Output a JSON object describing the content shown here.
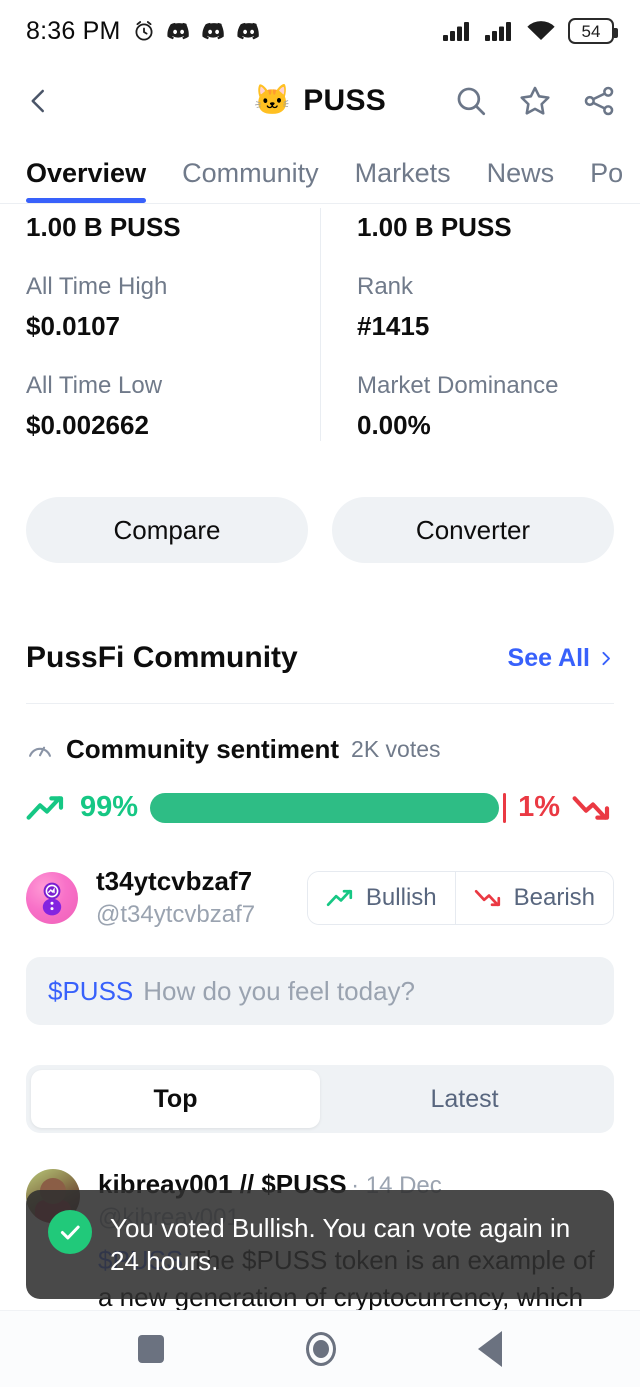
{
  "status_bar": {
    "time": "8:36 PM",
    "alarm_icon": "alarm-icon",
    "app_icons": [
      "discord-icon",
      "discord-icon",
      "discord-icon"
    ],
    "signal_icons": [
      "signal-bars-icon",
      "signal-bars-icon"
    ],
    "wifi_icon": "wifi-icon",
    "battery_percent": "54"
  },
  "app_bar": {
    "back_icon": "chevron-left-icon",
    "coin_logo": "🐱",
    "coin_name": "PUSS",
    "search_icon": "search-icon",
    "favorite_icon": "star-icon",
    "share_icon": "share-icon"
  },
  "tabs": [
    {
      "label": "Overview",
      "active": true
    },
    {
      "label": "Community",
      "active": false
    },
    {
      "label": "Markets",
      "active": false
    },
    {
      "label": "News",
      "active": false
    },
    {
      "label": "Po",
      "active": false
    }
  ],
  "stats": {
    "left": {
      "top_value": "1.00 B PUSS",
      "rows": [
        {
          "label": "All Time High",
          "value": "$0.0107"
        },
        {
          "label": "All Time Low",
          "value": "$0.002662"
        }
      ]
    },
    "right": {
      "top_value": "1.00 B PUSS",
      "rows": [
        {
          "label": "Rank",
          "value": "#1415"
        },
        {
          "label": "Market Dominance",
          "value": "0.00%"
        }
      ]
    }
  },
  "actions": {
    "compare_label": "Compare",
    "converter_label": "Converter"
  },
  "community": {
    "section_title": "PussFi Community",
    "see_all_label": "See All",
    "see_all_chevron": "chevron-right-icon",
    "sentiment": {
      "icon": "gauge-icon",
      "title": "Community sentiment",
      "votes": "2K votes",
      "bullish_pct": "99%",
      "bearish_pct": "1%",
      "bullish_value": 99,
      "bearish_value": 1,
      "bullish_color": "#2ebd85",
      "bearish_color": "#ea3943",
      "bullish_icon": "trend-up-icon",
      "bearish_icon": "trend-down-icon"
    },
    "current_user": {
      "name": "t34ytcvbzaf7",
      "handle": "@t34ytcvbzaf7",
      "avatar_icon": "cmc-avatar-icon",
      "bullish_label": "Bullish",
      "bearish_label": "Bearish"
    },
    "compose": {
      "cashtag": "$PUSS",
      "placeholder": "How do you feel today?"
    },
    "feed_filter": [
      {
        "label": "Top",
        "active": true
      },
      {
        "label": "Latest",
        "active": false
      }
    ],
    "posts": [
      {
        "name": "kibreay001 // $PUSS",
        "date": "· 14 Dec",
        "handle": "@kibreay001",
        "cashtag": "$PUSS",
        "body": " The $PUSS token is an example of a new generation of cryptocurrency, which can play a significant role in investing, trading, and"
      }
    ]
  },
  "toast": {
    "check_icon": "check-circle-icon",
    "message": "You voted Bullish. You can vote again in 24 hours."
  },
  "nav_bar": {
    "recents_icon": "square-recents-icon",
    "home_icon": "circle-home-icon",
    "back_icon": "triangle-back-icon"
  }
}
